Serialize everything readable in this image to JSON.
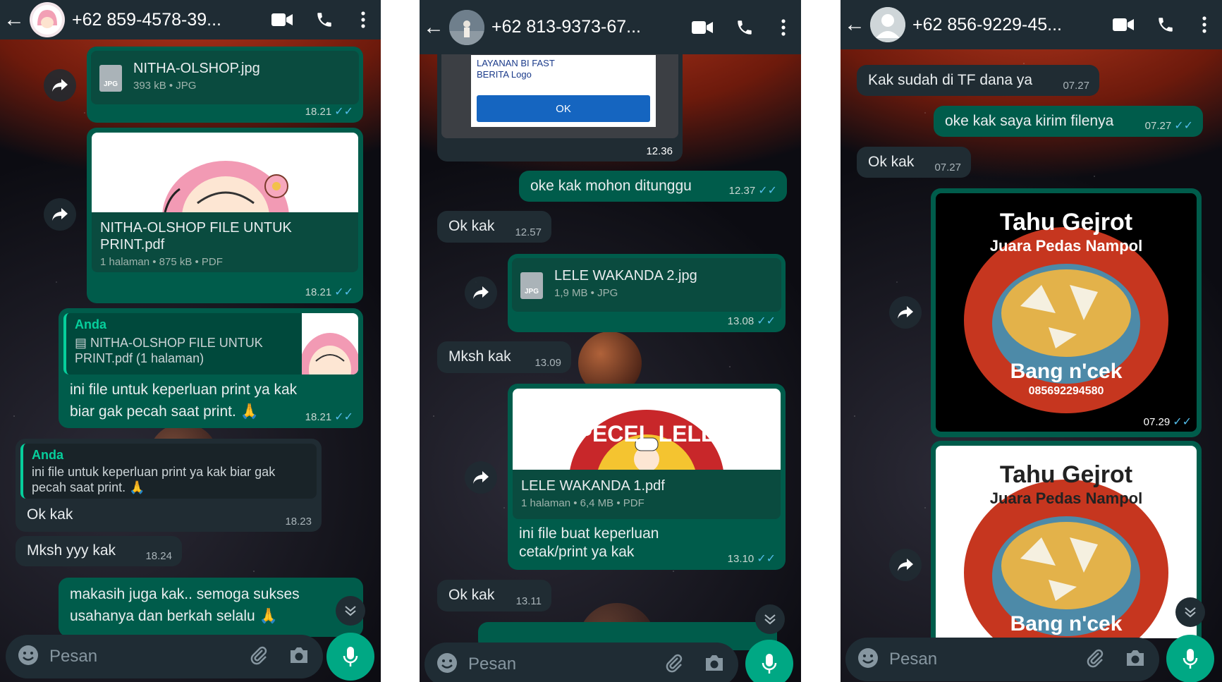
{
  "colors": {
    "header": "#1f2c34",
    "outgoing": "#005c4b",
    "incoming": "#202c33",
    "accent": "#00a884",
    "tick": "#53bdeb"
  },
  "icons": {
    "back": "arrow-left-icon",
    "video": "video-camera-icon",
    "call": "phone-icon",
    "menu": "more-vert-icon",
    "forward": "forward-icon",
    "emoji": "emoji-icon",
    "attach": "paperclip-icon",
    "camera": "camera-icon",
    "mic": "mic-icon",
    "scroll": "chevron-double-down-icon"
  },
  "tick": "✓✓",
  "input_placeholder": "Pesan",
  "p1": {
    "contact": "+62 859-4578-39...",
    "file1": {
      "name": "NITHA-OLSHOP.jpg",
      "meta": "393 kB • JPG",
      "time": "18.21",
      "type": "JPG"
    },
    "file2": {
      "name": "NITHA-OLSHOP FILE UNTUK PRINT.pdf",
      "meta": "1 halaman • 875 kB • PDF",
      "time": "18.21"
    },
    "reply1": {
      "quote_author": "Anda",
      "quote_text": "▤ NITHA-OLSHOP FILE UNTUK PRINT.pdf (1 halaman)",
      "text": "ini file untuk keperluan print ya kak biar gak pecah saat print. 🙏",
      "time": "18.21"
    },
    "reply2": {
      "quote_author": "Anda",
      "quote_text": "ini file untuk keperluan print ya kak biar gak pecah saat print. 🙏",
      "text": "Ok kak",
      "time": "18.23"
    },
    "msg3": {
      "text": "Mksh yyy kak",
      "time": "18.24"
    },
    "msg4": {
      "text": "makasih juga kak..  semoga sukses usahanya dan berkah selalu 🙏"
    }
  },
  "p2": {
    "contact": "+62 813-9373-67...",
    "img": {
      "line1": "LAYANAN BI FAST",
      "line2": "BERITA Logo",
      "ok": "OK",
      "time": "12.36"
    },
    "m1": {
      "text": "oke kak mohon ditunggu",
      "time": "12.37"
    },
    "m2": {
      "text": "Ok kak",
      "time": "12.57"
    },
    "file1": {
      "name": "LELE WAKANDA 2.jpg",
      "meta": "1,9 MB • JPG",
      "time": "13.08",
      "type": "JPG"
    },
    "m3": {
      "text": "Mksh kak",
      "time": "13.09"
    },
    "file2": {
      "name": "LELE WAKANDA 1.pdf",
      "meta": "1 halaman • 6,4 MB • PDF",
      "caption": "ini file buat keperluan cetak/print ya kak",
      "time": "13.10",
      "logo": "PECEL LELE"
    },
    "m4": {
      "text": "Ok kak",
      "time": "13.11"
    }
  },
  "p3": {
    "contact": "+62 856-9229-45...",
    "m1": {
      "text": "Kak sudah di TF dana ya",
      "time": "07.27"
    },
    "m2": {
      "text": "oke kak saya kirim filenya",
      "time": "07.27"
    },
    "m3": {
      "text": "Ok kak",
      "time": "07.27"
    },
    "img1": {
      "title": "Tahu Gejrot",
      "sub": "Juara Pedas Nampol",
      "brand": "Bang n'cek",
      "phone": "085692294580",
      "time": "07.29"
    },
    "img2": {
      "title": "Tahu Gejrot",
      "sub": "Juara Pedas Nampol",
      "brand": "Bang n'cek"
    }
  }
}
